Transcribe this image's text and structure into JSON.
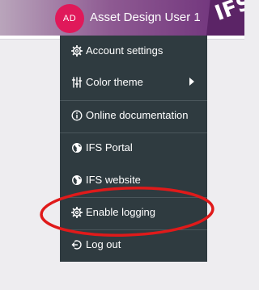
{
  "header": {
    "avatar_initials": "AD",
    "user_name": "Asset Design User 1",
    "logo_text": "IFS"
  },
  "colors": {
    "header_gradient_start": "#b9a5bb",
    "header_gradient_end": "#6b2d78",
    "avatar_bg": "#e0195a",
    "menu_bg": "#2f3b40",
    "annotation_ellipse": "#e01a1a"
  },
  "menu": {
    "items": [
      {
        "label": "Account settings",
        "icon": "gear-icon"
      },
      {
        "label": "Color theme",
        "icon": "sliders-icon",
        "has_submenu": true
      },
      {
        "label": "Online documentation",
        "icon": "info-icon"
      },
      {
        "label": "IFS Portal",
        "icon": "globe-icon"
      },
      {
        "label": "IFS website",
        "icon": "globe-icon"
      },
      {
        "label": "Enable logging",
        "icon": "gear-icon"
      },
      {
        "label": "Log out",
        "icon": "logout-icon"
      }
    ]
  }
}
